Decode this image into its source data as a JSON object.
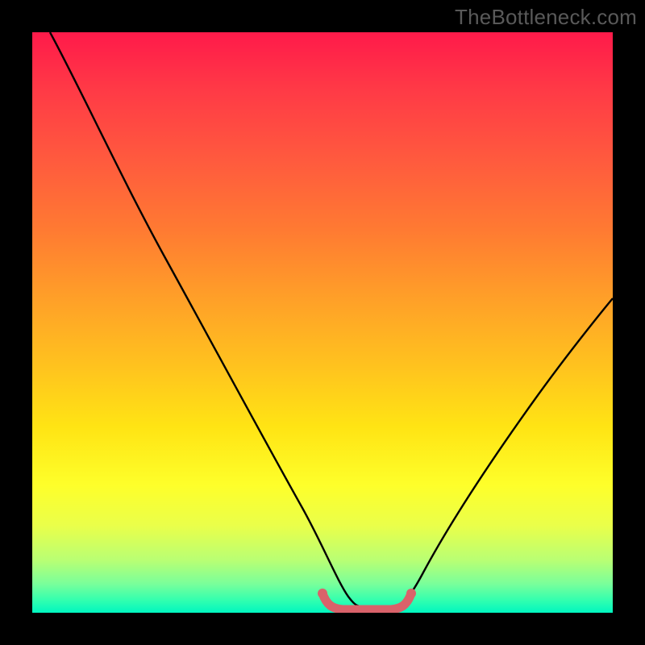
{
  "watermark": "TheBottleneck.com",
  "chart_data": {
    "type": "line",
    "title": "",
    "xlabel": "",
    "ylabel": "",
    "xlim": [
      0,
      100
    ],
    "ylim": [
      0,
      100
    ],
    "series": [
      {
        "name": "black-curve",
        "color": "#000000",
        "x": [
          3,
          10,
          20,
          30,
          40,
          48,
          50,
          52,
          56,
          62,
          64,
          72,
          80,
          90,
          100
        ],
        "y": [
          100,
          88,
          71,
          54,
          36,
          17,
          9,
          3,
          1,
          1,
          3,
          10,
          20,
          33,
          47
        ]
      },
      {
        "name": "pink-flat-segment",
        "color": "#d9626a",
        "x": [
          50,
          52,
          56,
          60,
          63,
          64
        ],
        "y": [
          3,
          1.2,
          1,
          1,
          1.2,
          3
        ]
      }
    ],
    "background_gradient": {
      "direction": "vertical",
      "stops": [
        {
          "pos": 0.0,
          "color": "#ff1a4a"
        },
        {
          "pos": 0.5,
          "color": "#ffc41e"
        },
        {
          "pos": 0.8,
          "color": "#feff2a"
        },
        {
          "pos": 1.0,
          "color": "#00f6c0"
        }
      ]
    }
  }
}
